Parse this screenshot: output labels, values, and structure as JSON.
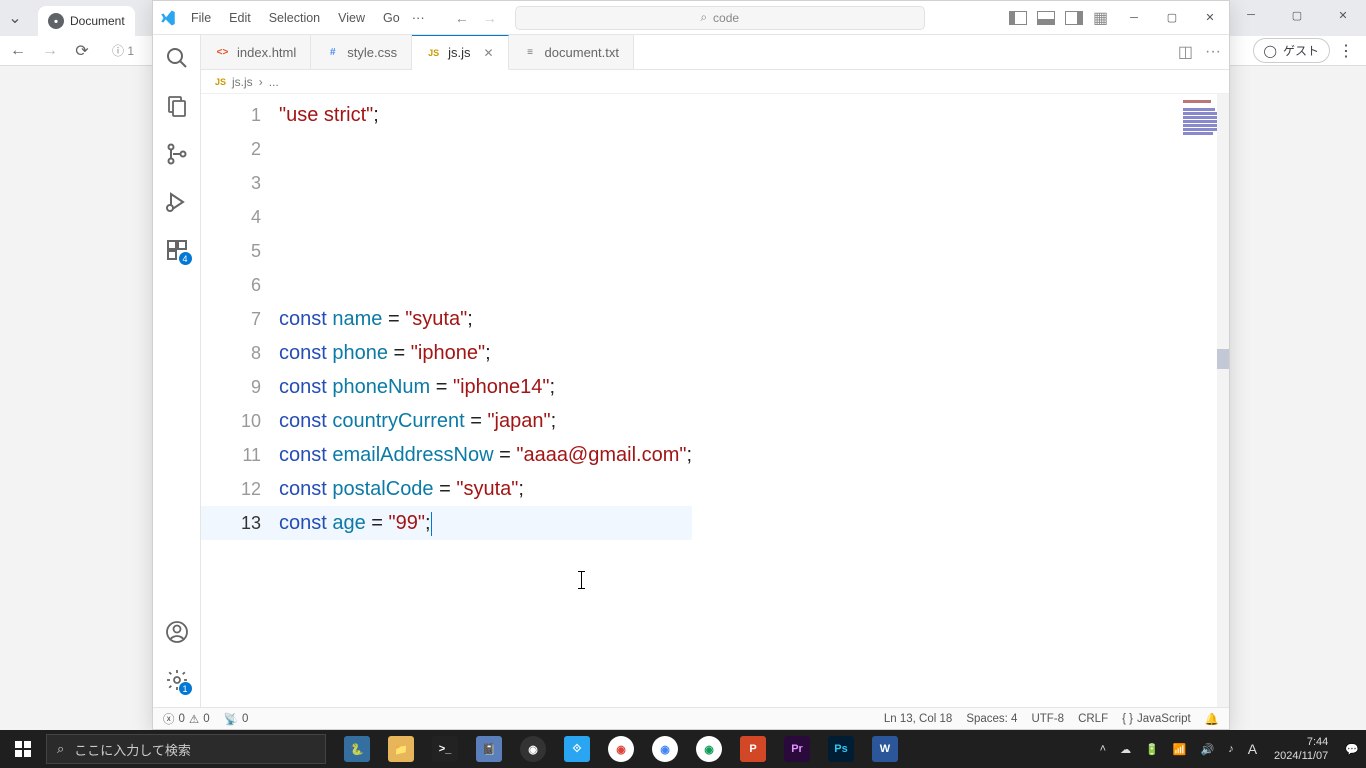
{
  "browser": {
    "tab_title": "Document",
    "profile": "ゲスト"
  },
  "vscode": {
    "menu": [
      "File",
      "Edit",
      "Selection",
      "View",
      "Go"
    ],
    "search_placeholder": "code",
    "tabs": [
      {
        "name": "index.html",
        "type": "html"
      },
      {
        "name": "style.css",
        "type": "css"
      },
      {
        "name": "js.js",
        "type": "js",
        "active": true
      },
      {
        "name": "document.txt",
        "type": "txt"
      }
    ],
    "breadcrumb": {
      "file": "js.js",
      "sep": "›",
      "rest": "..."
    },
    "ext_badge": "4",
    "settings_badge": "1",
    "status": {
      "errors": "0",
      "warnings": "0",
      "ports": "0",
      "lncol": "Ln 13, Col 18",
      "spaces": "Spaces: 4",
      "encoding": "UTF-8",
      "eol": "CRLF",
      "lang": "JavaScript"
    },
    "code": {
      "lines": [
        {
          "n": 1,
          "tokens": [
            [
              "str",
              "\"use strict\""
            ],
            [
              "op",
              ";"
            ]
          ]
        },
        {
          "n": 2,
          "tokens": []
        },
        {
          "n": 3,
          "tokens": []
        },
        {
          "n": 4,
          "tokens": []
        },
        {
          "n": 5,
          "tokens": []
        },
        {
          "n": 6,
          "tokens": []
        },
        {
          "n": 7,
          "tokens": [
            [
              "kw",
              "const"
            ],
            [
              "op",
              " "
            ],
            [
              "var",
              "name"
            ],
            [
              "op",
              " = "
            ],
            [
              "str",
              "\"syuta\""
            ],
            [
              "op",
              ";"
            ]
          ]
        },
        {
          "n": 8,
          "tokens": [
            [
              "kw",
              "const"
            ],
            [
              "op",
              " "
            ],
            [
              "var",
              "phone"
            ],
            [
              "op",
              " = "
            ],
            [
              "str",
              "\"iphone\""
            ],
            [
              "op",
              ";"
            ]
          ]
        },
        {
          "n": 9,
          "tokens": [
            [
              "kw",
              "const"
            ],
            [
              "op",
              " "
            ],
            [
              "var",
              "phoneNum"
            ],
            [
              "op",
              " = "
            ],
            [
              "str",
              "\"iphone14\""
            ],
            [
              "op",
              ";"
            ]
          ]
        },
        {
          "n": 10,
          "tokens": [
            [
              "kw",
              "const"
            ],
            [
              "op",
              " "
            ],
            [
              "var",
              "countryCurrent"
            ],
            [
              "op",
              " = "
            ],
            [
              "str",
              "\"japan\""
            ],
            [
              "op",
              ";"
            ]
          ]
        },
        {
          "n": 11,
          "tokens": [
            [
              "kw",
              "const"
            ],
            [
              "op",
              " "
            ],
            [
              "var",
              "emailAddressNow"
            ],
            [
              "op",
              " = "
            ],
            [
              "str",
              "\"aaaa@gmail.com\""
            ],
            [
              "op",
              ";"
            ]
          ]
        },
        {
          "n": 12,
          "tokens": [
            [
              "kw",
              "const"
            ],
            [
              "op",
              " "
            ],
            [
              "var",
              "postalCode"
            ],
            [
              "op",
              " = "
            ],
            [
              "str",
              "\"syuta\""
            ],
            [
              "op",
              ";"
            ]
          ]
        },
        {
          "n": 13,
          "tokens": [
            [
              "kw",
              "const"
            ],
            [
              "op",
              " "
            ],
            [
              "var",
              "age"
            ],
            [
              "op",
              " = "
            ],
            [
              "str",
              "\"99\""
            ],
            [
              "op",
              ";"
            ]
          ],
          "current": true,
          "cursor": true
        }
      ]
    }
  },
  "taskbar": {
    "search_placeholder": "ここに入力して検索",
    "ime": "A",
    "time": "7:44",
    "date": "2024/11/07"
  }
}
